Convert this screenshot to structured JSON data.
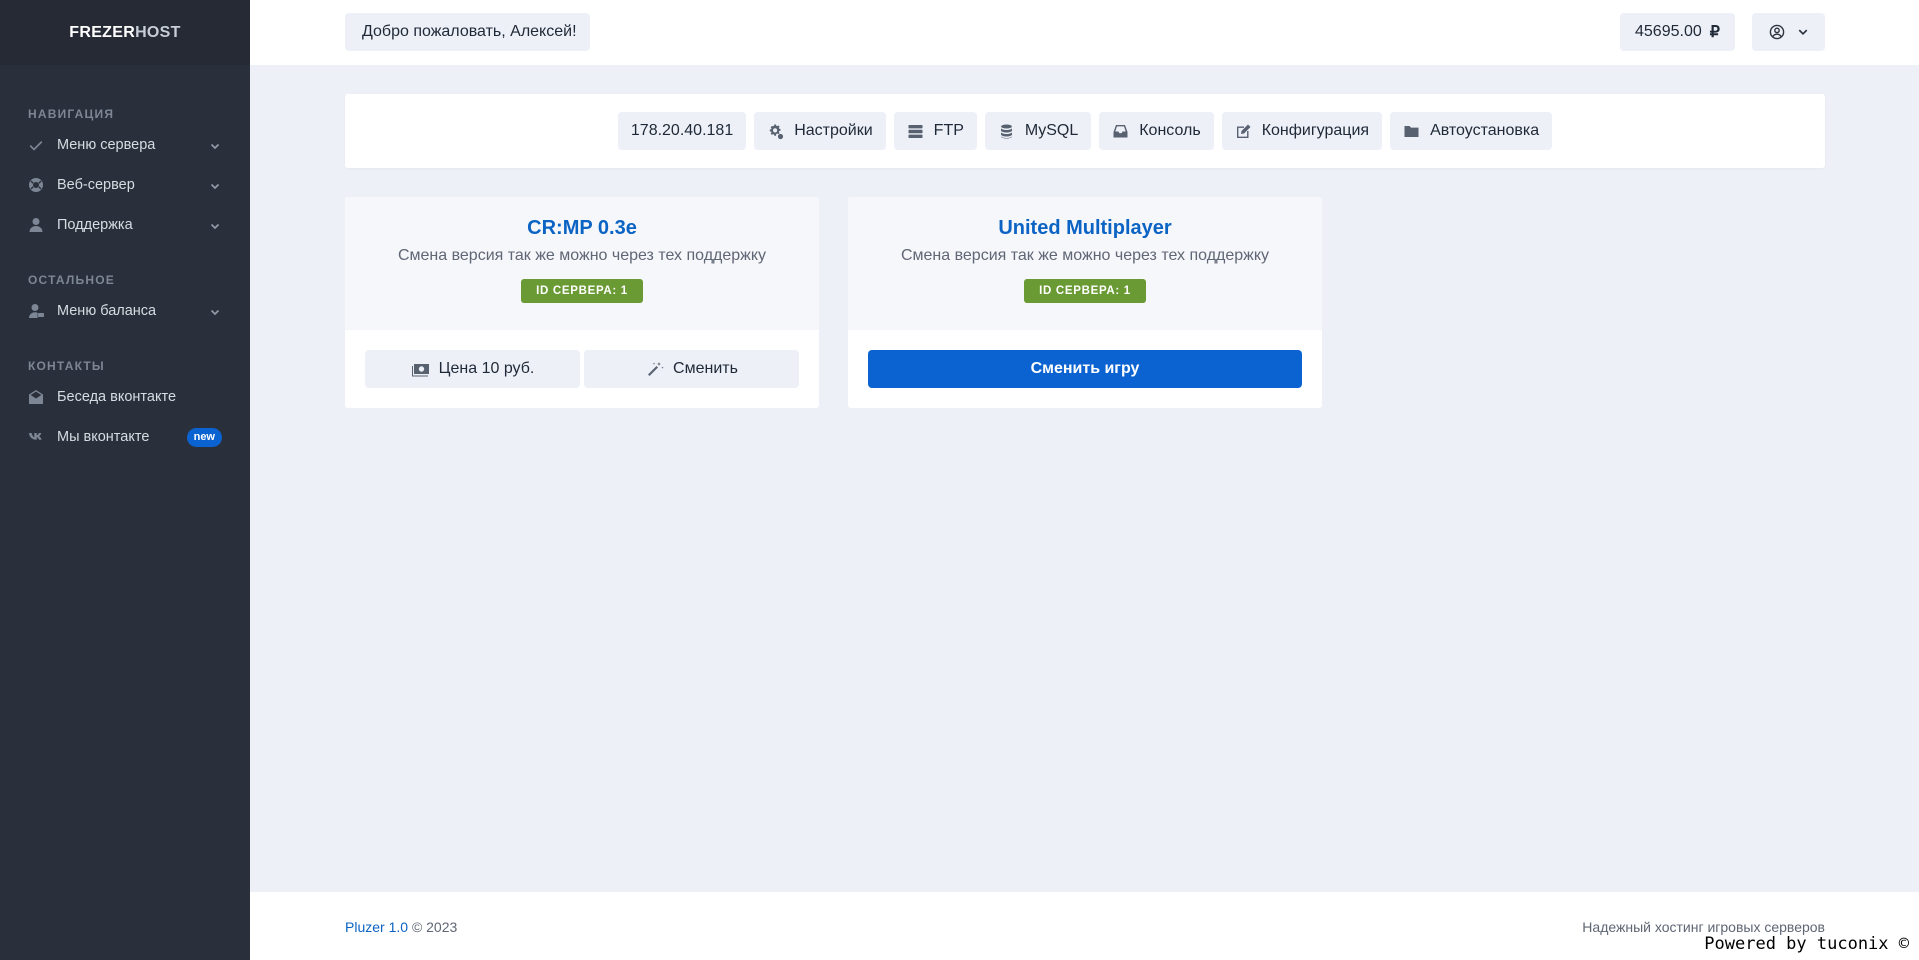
{
  "sidebar": {
    "brand_part1": "FREZER",
    "brand_part2": "HOST",
    "sections": {
      "nav": "Навигация",
      "other": "Остальное",
      "contacts": "Контакты"
    },
    "items": [
      {
        "label": "Меню сервера",
        "icon": "check-icon"
      },
      {
        "label": "Веб-сервер",
        "icon": "life-ring-icon"
      },
      {
        "label": "Поддержка",
        "icon": "user-icon"
      },
      {
        "label": "Меню баланса",
        "icon": "user-money-icon"
      },
      {
        "label": "Беседа вконтакте",
        "icon": "envelope-open-icon"
      },
      {
        "label": "Мы вконтакте",
        "icon": "vk-icon",
        "badge": "new"
      }
    ]
  },
  "header": {
    "welcome": "Добро пожаловать, Алексей!",
    "balance": "45695.00",
    "currency": "₽"
  },
  "toolbar": {
    "ip": "178.20.40.181",
    "buttons": [
      {
        "label": "Настройки",
        "icon": "cogs-icon"
      },
      {
        "label": "FTP",
        "icon": "server-icon"
      },
      {
        "label": "MySQL",
        "icon": "database-icon"
      },
      {
        "label": "Консоль",
        "icon": "inbox-icon"
      },
      {
        "label": "Конфигурация",
        "icon": "edit-icon"
      },
      {
        "label": "Автоустановка",
        "icon": "folder-icon"
      }
    ]
  },
  "cards": [
    {
      "title": "CR:MP 0.3e",
      "subtitle": "Смена версия так же можно через тех поддержку",
      "badge": "ID СЕРВЕРА: 1",
      "price_label": "Цена 10 руб.",
      "change_label": "Сменить"
    },
    {
      "title": "United Multiplayer",
      "subtitle": "Смена версия так же можно через тех поддержку",
      "badge": "ID СЕРВЕРА: 1",
      "action_label": "Сменить игру"
    }
  ],
  "footer": {
    "product": "Pluzer 1.0",
    "copyright": "© 2023",
    "tagline": "Надежный хостинг игровых серверов"
  },
  "overlay": {
    "powered": "Powered by tuconix ©"
  },
  "colors": {
    "accent": "#0b63d1",
    "sidebar_bg": "#2a303b",
    "badge_green": "#6a9a33",
    "page_bg": "#edf0f7"
  }
}
